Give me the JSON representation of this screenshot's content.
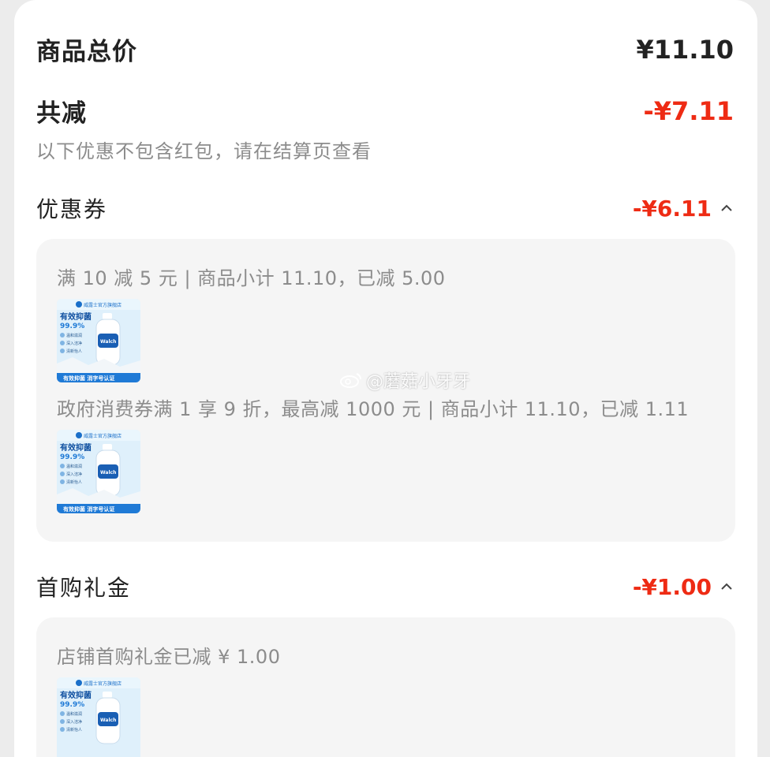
{
  "summary": {
    "total_label": "商品总价",
    "total_value": "¥11.10",
    "reduce_label": "共减",
    "reduce_value": "-¥7.11",
    "note": "以下优惠不包含红包，请在结算页查看"
  },
  "sections": [
    {
      "label": "优惠券",
      "amount": "-¥6.11",
      "items": [
        {
          "text": "满 10 减 5 元 | 商品小计 11.10，已减 5.00"
        },
        {
          "text": "政府消费券满 1 享 9 折，最高减 1000 元 | 商品小计 11.10，已减 1.11"
        }
      ]
    },
    {
      "label": "首购礼金",
      "amount": "-¥1.00",
      "items": [
        {
          "text": "店铺首购礼金已减 ¥ 1.00"
        }
      ]
    }
  ],
  "product_thumb": {
    "store_text": "威露士官方旗舰店",
    "headline": "有效抑菌",
    "percent": "99.9%",
    "features": [
      "温和滋润",
      "深入洁净",
      "清新怡人"
    ],
    "brand": "Walch",
    "footer": "有效抑菌 消字号认证"
  },
  "watermark": "@蘑菇小牙牙",
  "colors": {
    "accent_red": "#ee2b14",
    "panel_bg": "#f5f5f5",
    "text_dark": "#222222",
    "text_muted": "#8c8c8c"
  }
}
